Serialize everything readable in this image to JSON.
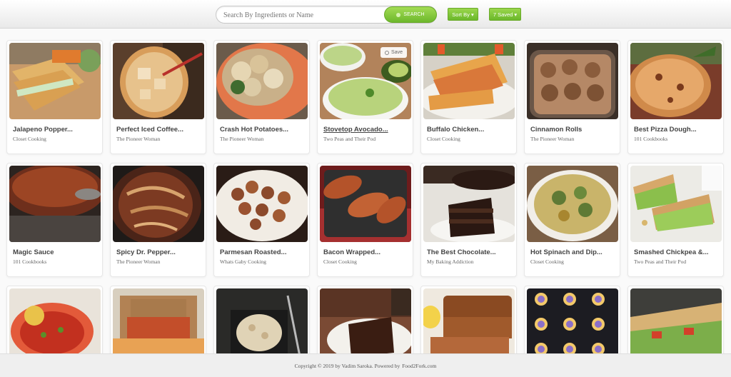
{
  "search": {
    "placeholder": "Search By Ingredients or Name",
    "button_label": "SEARCH"
  },
  "toolbar": {
    "sort_label": "Sort By ▾",
    "saved_label": "7 Saved ▾"
  },
  "save_tag_label": "Save",
  "recipes": [
    {
      "title": "Jalapeno Popper...",
      "publisher": "Closet Cooking"
    },
    {
      "title": "Perfect Iced Coffee...",
      "publisher": "The Pioneer Woman"
    },
    {
      "title": "Crash Hot Potatoes...",
      "publisher": "The Pioneer Woman"
    },
    {
      "title": "Stovetop Avocado...",
      "publisher": "Two Peas and Their Pod"
    },
    {
      "title": "Buffalo Chicken...",
      "publisher": "Closet Cooking"
    },
    {
      "title": "Cinnamon Rolls",
      "publisher": "The Pioneer Woman"
    },
    {
      "title": "Best Pizza Dough...",
      "publisher": "101 Cookbooks"
    },
    {
      "title": "Magic Sauce",
      "publisher": "101 Cookbooks"
    },
    {
      "title": "Spicy Dr. Pepper...",
      "publisher": "The Pioneer Woman"
    },
    {
      "title": "Parmesan Roasted...",
      "publisher": "Whats Gaby Cooking"
    },
    {
      "title": "Bacon Wrapped...",
      "publisher": "Closet Cooking"
    },
    {
      "title": "The Best Chocolate...",
      "publisher": "My Baking Addiction"
    },
    {
      "title": "Hot Spinach and Dip...",
      "publisher": "Closet Cooking"
    },
    {
      "title": "Smashed Chickpea &...",
      "publisher": "Two Peas and Their Pod"
    },
    {
      "title": "",
      "publisher": ""
    },
    {
      "title": "",
      "publisher": ""
    },
    {
      "title": "",
      "publisher": ""
    },
    {
      "title": "",
      "publisher": ""
    },
    {
      "title": "",
      "publisher": ""
    },
    {
      "title": "",
      "publisher": ""
    },
    {
      "title": "",
      "publisher": ""
    }
  ],
  "footer": {
    "copyright": "Copyright © 2019 by Vadim Saroka. Powered by",
    "link": "Food2Fork.com"
  },
  "colors": {
    "accent_green": "#7cc234",
    "card_border": "#e7e7e7"
  }
}
